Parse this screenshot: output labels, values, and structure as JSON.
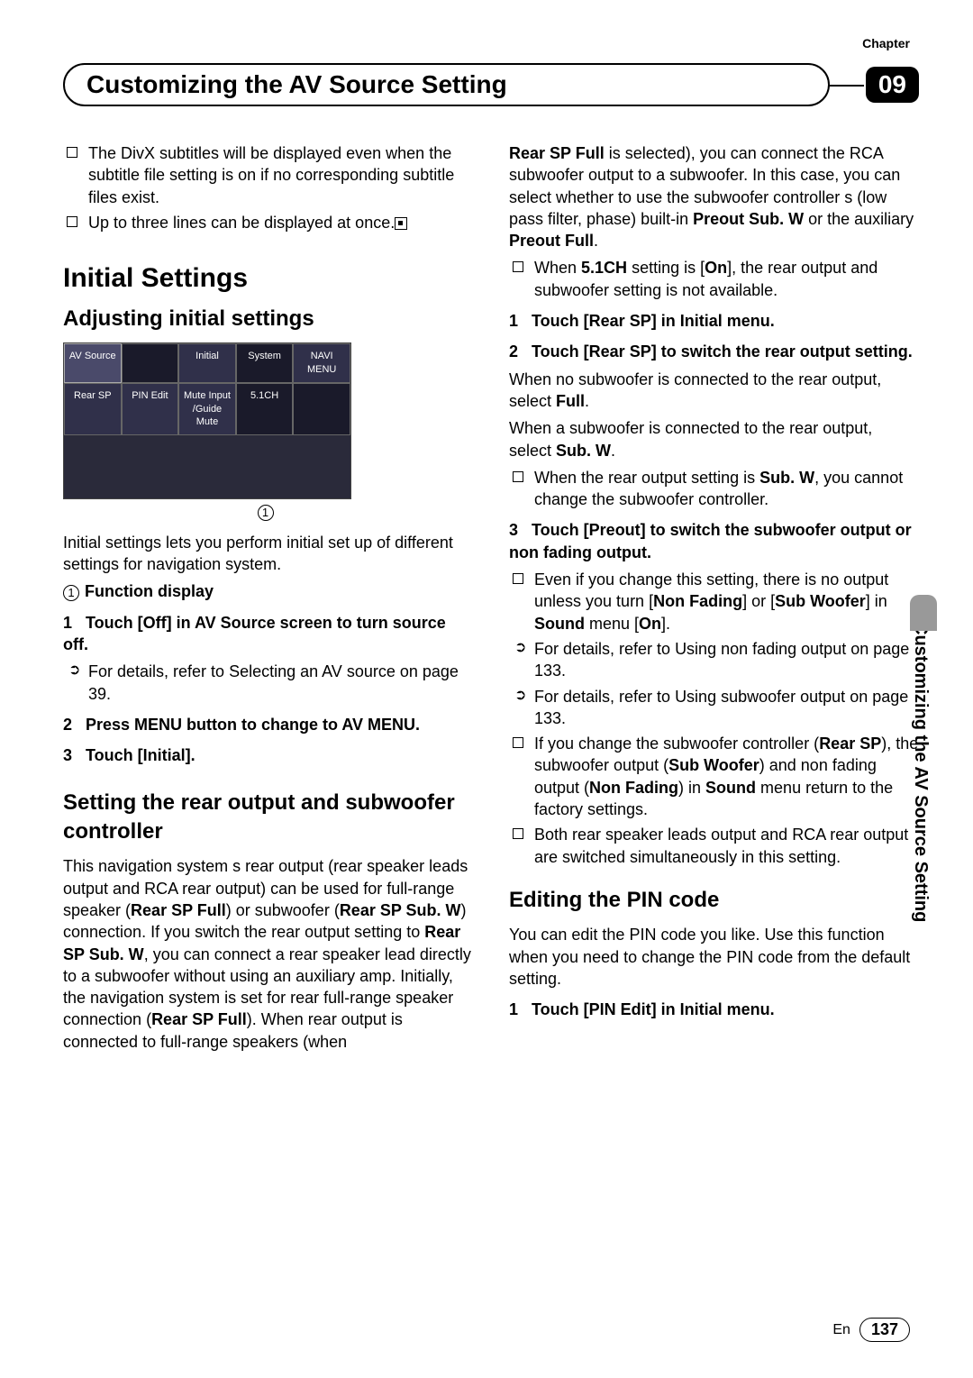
{
  "chapter_label": "Chapter",
  "chapter_number": "09",
  "header_title": "Customizing the AV Source Setting",
  "side_tab": "Customizing the AV Source Setting",
  "footer_lang": "En",
  "footer_page": "137",
  "left": {
    "bullets_top": [
      "The DivX subtitles will be displayed even when the subtitle file setting is on if no corresponding subtitle files exist.",
      "Up to three lines can be displayed at once."
    ],
    "h2": "Initial Settings",
    "h3a": "Adjusting initial settings",
    "screenshot": {
      "row1": [
        "AV Source",
        "",
        "Initial",
        "System",
        "NAVI MENU"
      ],
      "row2": [
        "Rear SP",
        "PIN Edit",
        "Mute Input /Guide Mute",
        "5.1CH",
        ""
      ]
    },
    "fig_mark": "1",
    "intro": "Initial settings lets you perform initial set up of different settings for navigation system.",
    "func_label": "Function display",
    "step1": "Touch [Off] in AV Source screen to turn source off.",
    "step1_sub_a": "For details, refer to ",
    "step1_sub_b": "Selecting an AV source",
    "step1_sub_c": " on page 39.",
    "step2": "Press MENU button to change to AV MENU.",
    "step3": "Touch [Initial].",
    "h3b": "Setting the rear output and subwoofer controller",
    "para_a": "This navigation system s rear output (rear speaker leads output and RCA rear output) can be used for full-range speaker (",
    "para_b": "Rear SP Full",
    "para_c": ") or subwoofer (",
    "para_d": "Rear SP Sub. W",
    "para_e": ") connection. If you switch the rear output setting to ",
    "para_f": "Rear SP Sub. W",
    "para_g": ", you can connect a rear speaker lead directly to a subwoofer without using an auxiliary amp. Initially, the navigation system is set for rear full-range speaker connection (",
    "para_h": "Rear SP Full",
    "para_i": "). When rear output is connected to full-range speakers (when"
  },
  "right": {
    "contA": "Rear SP Full",
    "contB": " is selected), you can connect the RCA subwoofer output to a subwoofer. In this case, you can select whether to use the subwoofer controller s (low pass filter, phase) built-in ",
    "contC": "Preout Sub. W",
    "contD": " or the auxiliary ",
    "contE": "Preout Full",
    "contF": ".",
    "bullet1a": "When ",
    "bullet1b": "5.1CH",
    "bullet1c": " setting is [",
    "bullet1d": "On",
    "bullet1e": "], the rear output and subwoofer setting is not available.",
    "step1": "Touch [Rear SP] in Initial menu.",
    "step2": "Touch [Rear SP] to switch the rear output setting.",
    "step2_p1a": "When no subwoofer is connected to the rear output, select ",
    "step2_p1b": "Full",
    "step2_p2a": "When a subwoofer is connected to the rear output, select ",
    "step2_p2b": "Sub. W",
    "step2_bullet_a": "When the rear output setting is ",
    "step2_bullet_b": "Sub. W",
    "step2_bullet_c": ", you cannot change the subwoofer controller.",
    "step3": "Touch [Preout] to switch the subwoofer output or non fading output.",
    "s3_b1a": "Even if you change this setting, there is no output unless you turn [",
    "s3_b1b": "Non Fading",
    "s3_b1c": "] or [",
    "s3_b1d": "Sub Woofer",
    "s3_b1e": "] in ",
    "s3_b1f": "Sound",
    "s3_b1g": " menu [",
    "s3_b1h": "On",
    "s3_b1i": "].",
    "s3_a1a": "For details, refer to ",
    "s3_a1b": "Using non fading output",
    "s3_a1c": " on page 133.",
    "s3_a2a": "For details, refer to ",
    "s3_a2b": "Using subwoofer output",
    "s3_a2c": " on page 133.",
    "s3_b2a": "If you change the subwoofer controller (",
    "s3_b2b": "Rear SP",
    "s3_b2c": "), the subwoofer output (",
    "s3_b2d": "Sub Woofer",
    "s3_b2e": ") and non fading output (",
    "s3_b2f": "Non Fading",
    "s3_b2g": ") in ",
    "s3_b2h": "Sound",
    "s3_b2i": " menu return to the factory settings.",
    "s3_b3": "Both rear speaker leads output and RCA rear output are switched simultaneously in this setting.",
    "h3c": "Editing the PIN code",
    "pin_intro": "You can edit the PIN code you like. Use this function when you need to change the PIN code from the default setting.",
    "pin_step1": "Touch [PIN Edit] in Initial menu."
  }
}
